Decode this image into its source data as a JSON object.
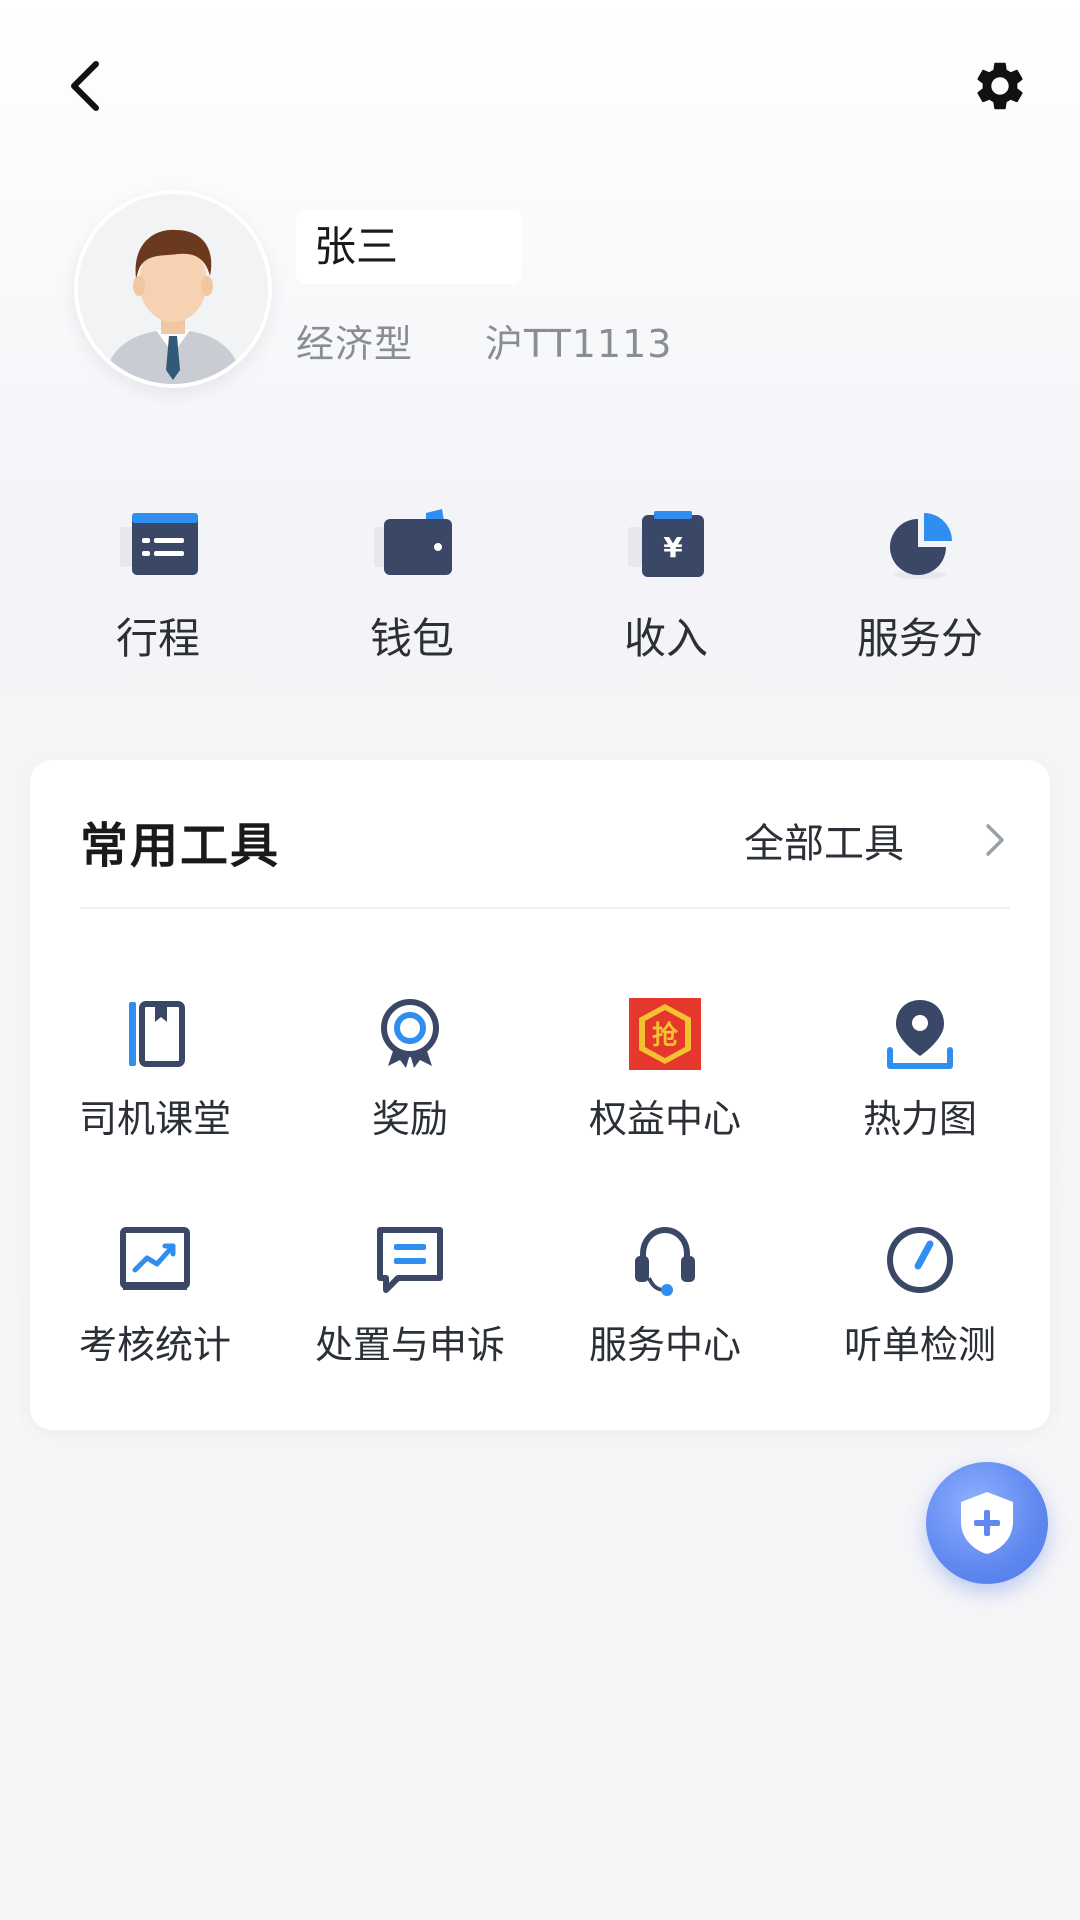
{
  "profile": {
    "name": "张三",
    "car_type": "经济型",
    "plate": "沪TT1113"
  },
  "quick_entries": [
    {
      "label": "行程",
      "icon": "trip-list-icon"
    },
    {
      "label": "钱包",
      "icon": "wallet-icon"
    },
    {
      "label": "收入",
      "icon": "income-yuan-icon"
    },
    {
      "label": "服务分",
      "icon": "pie-chart-icon"
    }
  ],
  "tools": {
    "title": "常用工具",
    "all_label": "全部工具",
    "items": [
      {
        "label": "司机课堂",
        "icon": "book-icon"
      },
      {
        "label": "奖励",
        "icon": "medal-icon"
      },
      {
        "label": "权益中心",
        "icon": "grab-badge-icon"
      },
      {
        "label": "热力图",
        "icon": "location-pin-icon"
      },
      {
        "label": "考核统计",
        "icon": "trend-chart-icon"
      },
      {
        "label": "处置与申诉",
        "icon": "message-icon"
      },
      {
        "label": "服务中心",
        "icon": "headset-icon"
      },
      {
        "label": "听单检测",
        "icon": "gauge-icon"
      }
    ]
  },
  "colors": {
    "icon_dark": "#3a4766",
    "icon_blue": "#2f8ef0",
    "fab_blue": "#5f88f0"
  },
  "icons": {
    "back": "back-arrow-icon",
    "settings": "gear-icon",
    "safety": "shield-plus-icon"
  }
}
